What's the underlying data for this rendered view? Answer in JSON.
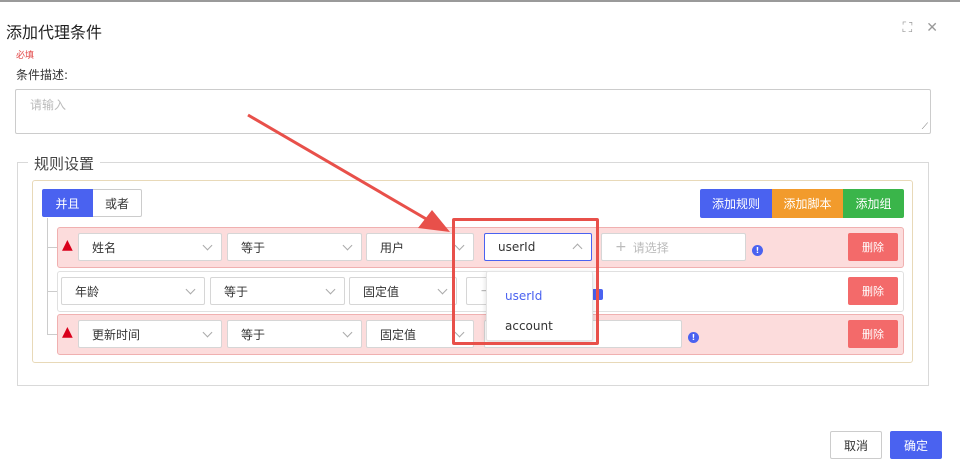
{
  "dialog": {
    "title": "添加代理条件"
  },
  "form": {
    "required_mark": "必填",
    "description_label": "条件描述:",
    "description_placeholder": "请输入"
  },
  "rules": {
    "section_title": "规则设置",
    "connector": {
      "and_label": "并且",
      "or_label": "或者",
      "selected": "并且"
    },
    "actions": {
      "add_rule": "添加规则",
      "add_script": "添加脚本",
      "add_group": "添加组"
    },
    "rows": [
      {
        "field": "姓名",
        "operator": "等于",
        "value_type": "用户",
        "value": "userId",
        "extra_placeholder": "请选择",
        "delete_label": "删除",
        "state": "error"
      },
      {
        "field": "年龄",
        "operator": "等于",
        "value_type": "固定值",
        "value": "",
        "delete_label": "删除",
        "state": "normal"
      },
      {
        "field": "更新时间",
        "operator": "等于",
        "value_type": "固定值",
        "value": "",
        "delete_label": "删除",
        "state": "error"
      }
    ],
    "dropdown_options": [
      "userId",
      "account"
    ],
    "dropdown_selected": "userId"
  },
  "footer": {
    "cancel_label": "取消",
    "confirm_label": "确定"
  },
  "colors": {
    "primary": "#4a62f0",
    "script": "#f29b2c",
    "group": "#3ab54a",
    "danger": "#f36a6a",
    "highlight": "#e8504a"
  },
  "icons": [
    "maximize-icon",
    "close-icon",
    "warning-icon",
    "chevron-down-icon",
    "chevron-up-icon",
    "plus-icon",
    "info-icon"
  ]
}
